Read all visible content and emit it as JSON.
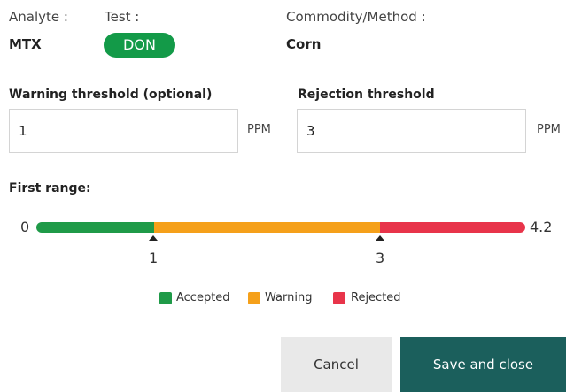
{
  "header": {
    "analyte_label": "Analyte :",
    "analyte_value": "MTX",
    "test_label": "Test :",
    "test_value": "DON",
    "commodity_label": "Commodity/Method :",
    "commodity_value": "Corn"
  },
  "thresholds": {
    "warning_label": "Warning threshold (optional)",
    "warning_value": "1",
    "warning_unit": "PPM",
    "rejection_label": "Rejection threshold",
    "rejection_value": "3",
    "rejection_unit": "PPM"
  },
  "range": {
    "title": "First range:",
    "min": "0",
    "max": "4.2",
    "warning_marker": "1",
    "rejection_marker": "3"
  },
  "legend": {
    "accepted": "Accepted",
    "warning": "Warning",
    "rejected": "Rejected"
  },
  "colors": {
    "accepted": "#1f9a48",
    "warning": "#f5a01a",
    "rejected": "#e8344a",
    "test_pill": "#139a48",
    "primary_button": "#1b5f5c"
  },
  "buttons": {
    "cancel": "Cancel",
    "save": "Save and close"
  }
}
